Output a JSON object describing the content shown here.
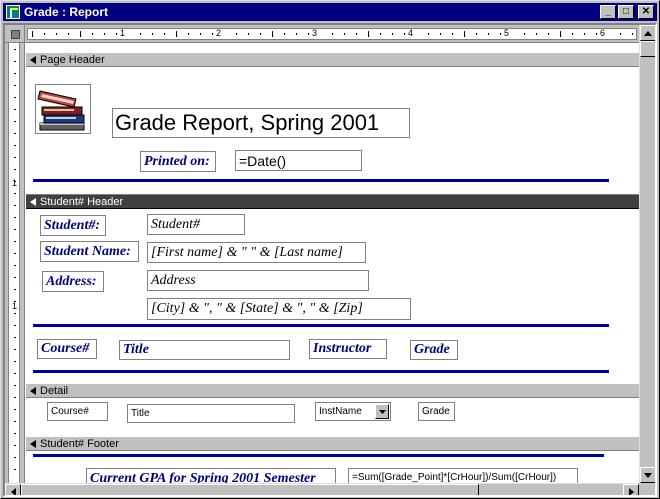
{
  "window": {
    "title": "Grade : Report",
    "minimize_glyph": "_",
    "maximize_glyph": "□",
    "close_glyph": "✕"
  },
  "ruler": {
    "numbers": [
      "1",
      "2",
      "3",
      "4",
      "5",
      "6"
    ],
    "vertical_numbers": [
      "1",
      "1"
    ]
  },
  "sections": {
    "page_header": "Page Header",
    "student_header": "Student# Header",
    "detail": "Detail",
    "student_footer": "Student# Footer"
  },
  "page_header": {
    "title": "Grade Report, Spring 2001",
    "printed_on_label": "Printed on:",
    "date_expr": "=Date()"
  },
  "student_header": {
    "student_num_label": "Student#:",
    "student_num_field": "Student#",
    "student_name_label": "Student Name:",
    "student_name_field": "[First name] & \" \" & [Last name]",
    "address_label": "Address:",
    "address_field": "Address",
    "city_field": "[City] & \", \" & [State] & \", \" & [Zip]",
    "col_course": "Course#",
    "col_title": "Title",
    "col_instructor": "Instructor",
    "col_grade": "Grade"
  },
  "detail": {
    "course": "Course#",
    "title": "Title",
    "instname": "InstName",
    "grade": "Grade"
  },
  "footer": {
    "gpa_label": "Current GPA for Spring 2001 Semester",
    "gpa_expr": "=Sum([Grade_Point]*[CrHour])/Sum([CrHour])"
  },
  "colors": {
    "titlebar": "#000080",
    "label_text": "#000080",
    "rule_line": "#0000a0",
    "band_dark": "#404040"
  },
  "icons": [
    "report-window-icon",
    "books-image",
    "section-arrow-icon",
    "combo-dropdown-icon",
    "scroll-up-icon",
    "scroll-down-icon",
    "scroll-left-icon",
    "scroll-right-icon"
  ]
}
